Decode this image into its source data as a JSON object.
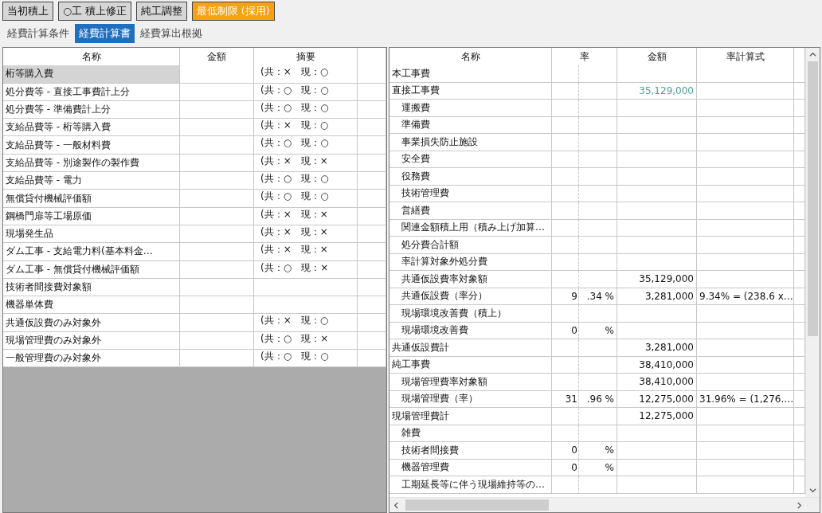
{
  "toolbar": {
    "buttons": [
      {
        "label": "当初積上",
        "selected": false
      },
      {
        "label": "○工 積上修正",
        "selected": false
      },
      {
        "label": "純工調整",
        "selected": false
      },
      {
        "label": "最低制限 (採用)",
        "selected": true
      }
    ]
  },
  "tabs": [
    {
      "label": "経費計算条件",
      "selected": false
    },
    {
      "label": "経費計算書",
      "selected": true
    },
    {
      "label": "経費算出根拠",
      "selected": false
    }
  ],
  "left_table": {
    "columns": [
      "名称",
      "金額",
      "摘要"
    ],
    "rows": [
      {
        "name": "桁等購入費",
        "summary": "(共：×　現：○",
        "selected": true
      },
      {
        "name": "処分費等 - 直接工事費計上分",
        "summary": "(共：○　現：○",
        "selected": false
      },
      {
        "name": "処分費等 - 準備費計上分",
        "summary": "(共：○　現：○",
        "selected": false
      },
      {
        "name": "支給品費等 - 桁等購入費",
        "summary": "(共：×　現：○",
        "selected": false
      },
      {
        "name": "支給品費等 - 一般材料費",
        "summary": "(共：○　現：○",
        "selected": false
      },
      {
        "name": "支給品費等 - 別途製作の製作費",
        "summary": "(共：×　現：×",
        "selected": false
      },
      {
        "name": "支給品費等 - 電力",
        "summary": "(共：○　現：○",
        "selected": false
      },
      {
        "name": "無償貸付機械評価額",
        "summary": "(共：○　現：○",
        "selected": false
      },
      {
        "name": "鋼橋門扉等工場原価",
        "summary": "(共：×　現：×",
        "selected": false
      },
      {
        "name": "現場発生品",
        "summary": "(共：×　現：×",
        "selected": false
      },
      {
        "name": "ダム工事 - 支給電力料(基本料金…",
        "summary": "(共：×　現：×",
        "selected": false
      },
      {
        "name": "ダム工事 - 無償貸付機械評価額",
        "summary": "(共：○　現：×",
        "selected": false
      },
      {
        "name": "技術者間接費対象額",
        "selected": false
      },
      {
        "name": "機器単体費",
        "selected": false
      },
      {
        "name": "共通仮設費のみ対象外",
        "summary": "(共：×　現：○",
        "selected": false
      },
      {
        "name": "現場管理費のみ対象外",
        "summary": "(共：○　現：×",
        "selected": false
      },
      {
        "name": "一般管理費のみ対象外",
        "summary": "(共：○　現：○",
        "selected": false
      }
    ]
  },
  "right_table": {
    "columns": [
      "名称",
      "率",
      "金額",
      "率計算式"
    ],
    "rows": [
      {
        "name": "本工事費"
      },
      {
        "name": "直接工事費",
        "amount": "35,129,000",
        "emphasis": true,
        "children": [
          {
            "name": "運搬費"
          },
          {
            "name": "準備費"
          },
          {
            "name": "事業損失防止施設"
          },
          {
            "name": "安全費"
          },
          {
            "name": "役務費"
          },
          {
            "name": "技術管理費"
          },
          {
            "name": "営繕費"
          },
          {
            "name": "関連金額積上用（積み上げ加算…"
          },
          {
            "name": "処分費合計額"
          },
          {
            "name": "率計算対象外処分費"
          },
          {
            "name": "共通仮設費率対象額",
            "amount": "35,129,000",
            "emphasis": false
          },
          {
            "name": "共通仮設費（率分）",
            "rate_int": "9",
            "rate_frac": ".34 %",
            "amount": "3,281,000",
            "formula": "9.34% = (238.6 x…",
            "emphasis": false
          },
          {
            "name": "現場環境改善費（積上）"
          },
          {
            "name": "現場環境改善費",
            "rate_int": "0",
            "rate_frac": "%"
          }
        ]
      },
      {
        "name": "共通仮設費計",
        "amount": "3,281,000",
        "emphasis": false
      },
      {
        "name": "純工事費",
        "amount": "38,410,000",
        "emphasis": false,
        "children": [
          {
            "name": "現場管理費率対象額",
            "amount": "38,410,000",
            "emphasis": false
          },
          {
            "name": "現場管理費（率）",
            "rate_int": "31",
            "rate_frac": ".96 %",
            "amount": "12,275,000",
            "formula": "31.96% = (1,276.…",
            "emphasis": false
          }
        ]
      },
      {
        "name": "現場管理費計",
        "amount": "12,275,000",
        "emphasis": false,
        "children": [
          {
            "name": "雑費"
          },
          {
            "name": "技術者間接費",
            "rate_int": "0",
            "rate_frac": "%"
          },
          {
            "name": "機器管理費",
            "rate_int": "0",
            "rate_frac": "%"
          },
          {
            "name": "工期延長等に伴う現場維持等の…"
          }
        ]
      }
    ]
  }
}
